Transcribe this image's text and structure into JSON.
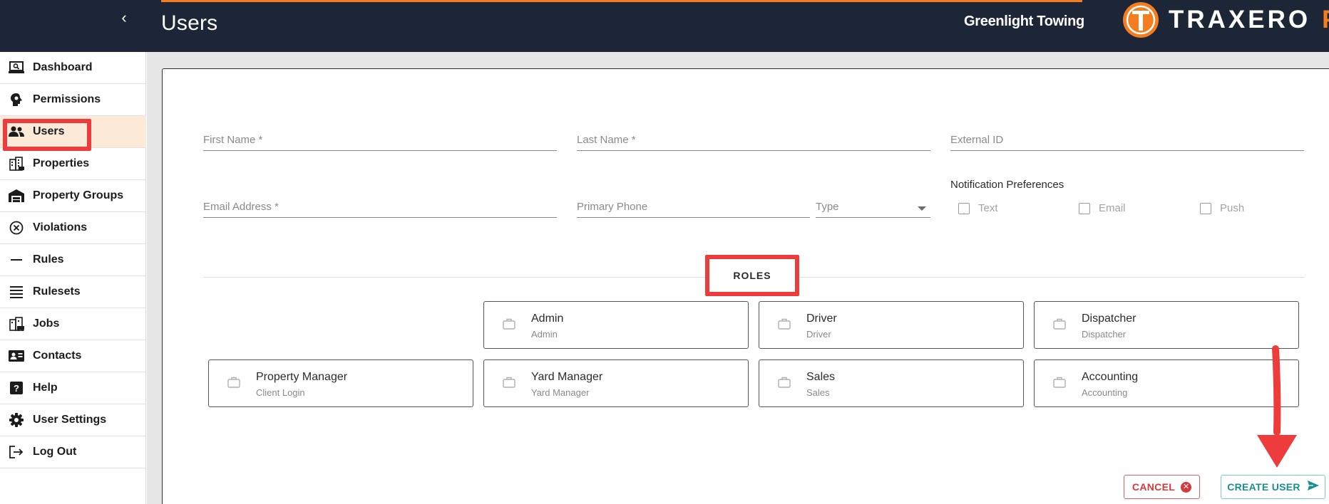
{
  "header": {
    "collapse_icon": "chevron-left-icon",
    "title": "Users",
    "company": "Greenlight Towing",
    "logo_text": "TRAXERO",
    "logo_suffix": "PP",
    "accent_color": "#f57d20"
  },
  "sidebar": {
    "items": [
      {
        "label": "Dashboard",
        "icon": "laptop-search-icon"
      },
      {
        "label": "Permissions",
        "icon": "permissions-icon"
      },
      {
        "label": "Users",
        "icon": "users-icon",
        "active": true
      },
      {
        "label": "Properties",
        "icon": "buildings-icon"
      },
      {
        "label": "Property Groups",
        "icon": "warehouse-icon"
      },
      {
        "label": "Violations",
        "icon": "circle-x-icon"
      },
      {
        "label": "Rules",
        "icon": "dash-icon"
      },
      {
        "label": "Rulesets",
        "icon": "list-icon"
      },
      {
        "label": "Jobs",
        "icon": "tow-icon"
      },
      {
        "label": "Contacts",
        "icon": "contact-card-icon"
      },
      {
        "label": "Help",
        "icon": "help-icon"
      },
      {
        "label": "User Settings",
        "icon": "gear-icon"
      },
      {
        "label": "Log Out",
        "icon": "logout-icon"
      }
    ]
  },
  "form": {
    "first_name": "First Name *",
    "last_name": "Last Name *",
    "external_id": "External ID",
    "email": "Email Address *",
    "primary_phone": "Primary Phone",
    "type": "Type",
    "notifications": {
      "title": "Notification Preferences",
      "options": [
        {
          "label": "Text",
          "checked": false
        },
        {
          "label": "Email",
          "checked": false
        },
        {
          "label": "Push",
          "checked": false
        }
      ]
    }
  },
  "roles": {
    "title": "ROLES",
    "items": [
      {
        "title": "Admin",
        "subtitle": "Admin"
      },
      {
        "title": "Driver",
        "subtitle": "Driver"
      },
      {
        "title": "Dispatcher",
        "subtitle": "Dispatcher"
      },
      {
        "title": "Property Manager",
        "subtitle": "Client Login"
      },
      {
        "title": "Yard Manager",
        "subtitle": "Yard Manager"
      },
      {
        "title": "Sales",
        "subtitle": "Sales"
      },
      {
        "title": "Accounting",
        "subtitle": "Accounting"
      }
    ]
  },
  "actions": {
    "cancel": "CANCEL",
    "create": "CREATE USER",
    "cancel_color": "#d43a3a",
    "create_color": "#1a8f8f"
  },
  "annotation_color": "#ee3b3b"
}
